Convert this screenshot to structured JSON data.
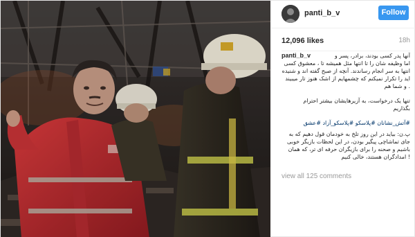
{
  "header": {
    "username": "panti_b_v",
    "follow_label": "Follow"
  },
  "post": {
    "likes": "12,096 likes",
    "time_ago": "18h",
    "caption_username": "panti_b_v",
    "caption": {
      "block1": [
        "آنها پدر کسی بودند، برادر، پسر و",
        "اما وظیفه شان را تا انتها مثل همیشه تا ، معشوق کسی",
        "انتها به سر انجام رساندند. آنچه از صبح گفته اند و شنیده",
        "اید را تکرار نمیکنم که چشمهایم از اشک هنوز تار میبیند",
        ". و شما هم"
      ],
      "block2": [
        "تنها یک درخواست، به آزیرهایشان بیشتر احترام",
        "بگذاریم"
      ],
      "hashtags": "#آتش_نشانان #پلاسکو #پلاسکو_آزاد #عشق",
      "block3": [
        "پ.ن: بیاید در این روز تلخ به خودمان قول دهیم که به",
        "جای تماشاچی پیگیر بودن، در این لحظات بازیگر خوبی",
        "باشیم و صحنه را برای بازیگران حرفه ای تر، که همان",
        "! امدادگران هستند، خالی کنیم"
      ]
    },
    "view_comments": "view all 125 comments"
  },
  "colors": {
    "follow_button": "#3897f0",
    "hashtag": "#003569",
    "muted": "#999999"
  }
}
